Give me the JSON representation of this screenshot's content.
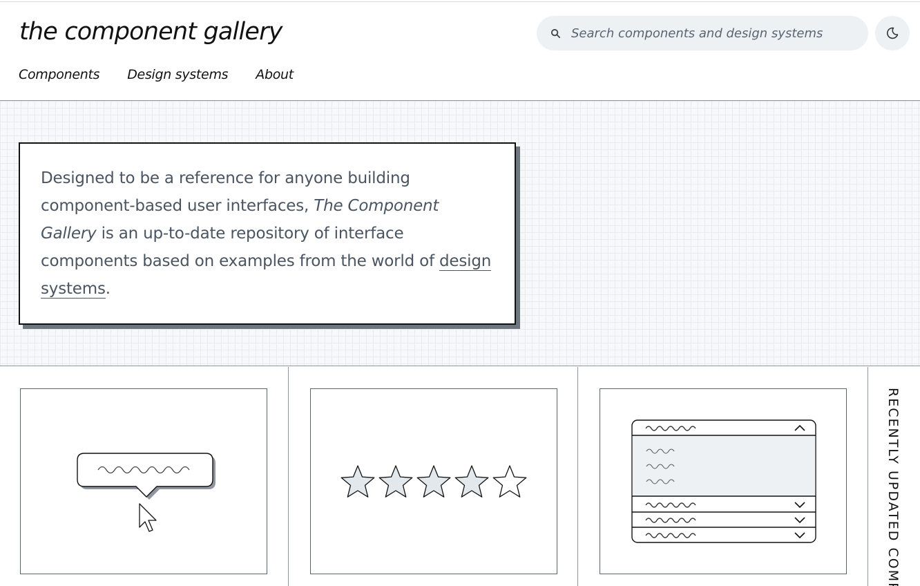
{
  "site": {
    "title": "the component gallery"
  },
  "search": {
    "placeholder": "Search components and design systems"
  },
  "nav": {
    "items": [
      {
        "label": "Components"
      },
      {
        "label": "Design systems"
      },
      {
        "label": "About"
      }
    ]
  },
  "intro": {
    "text_before": "Designed to be a reference for anyone building component-based user interfaces, ",
    "title_em": "The Component Gallery",
    "text_middle": " is an up-to-date repository of interface components based on examples from the world of ",
    "link_text": "design systems",
    "text_after": "."
  },
  "cards": [
    {
      "icon": "tooltip-illustration"
    },
    {
      "icon": "rating-illustration"
    },
    {
      "icon": "accordion-illustration"
    }
  ],
  "recent": {
    "label": "RECENTLY UPDATED COMP"
  },
  "colors": {
    "border": "#111111",
    "muted_text": "#4a5561",
    "search_bg": "#eef1f4",
    "illustration_fill": "#e3e8ec"
  }
}
